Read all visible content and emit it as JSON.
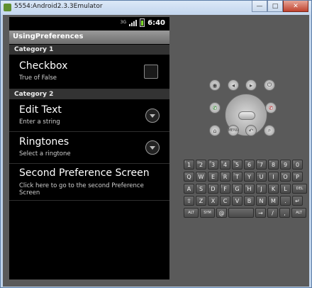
{
  "window": {
    "title": "5554:Android2.3.3Emulator",
    "min": "—",
    "max": "□",
    "close": "✕"
  },
  "status": {
    "net": "3G",
    "clock": "6:40"
  },
  "app": {
    "title": "UsingPreferences"
  },
  "categories": [
    "Category 1",
    "Category 2"
  ],
  "prefs": [
    {
      "title": "Checkbox",
      "summary": "True of False",
      "widget": "checkbox"
    },
    {
      "title": "Edit Text",
      "summary": "Enter a string",
      "widget": "arrow"
    },
    {
      "title": "Ringtones",
      "summary": "Select a ringtone",
      "widget": "arrow"
    },
    {
      "title": "Second Preference Screen",
      "summary": "Click here to go to the second Preference Screen",
      "widget": "none"
    }
  ],
  "hw": {
    "camera": "◉",
    "vol_down": "◂",
    "vol_up": "▸",
    "power": "⏻",
    "call": "✆",
    "end": "✆",
    "home": "⌂",
    "menu": "MENU",
    "back": "↶",
    "search": "⌕"
  },
  "keyboard": {
    "row1": [
      [
        "1",
        "!"
      ],
      [
        "2",
        "@"
      ],
      [
        "3",
        "#"
      ],
      [
        "4",
        "$"
      ],
      [
        "5",
        "%"
      ],
      [
        "6",
        "^"
      ],
      [
        "7",
        "&"
      ],
      [
        "8",
        "*"
      ],
      [
        "9",
        "("
      ],
      [
        "0",
        ")"
      ]
    ],
    "row2": [
      [
        "Q",
        "~"
      ],
      [
        "W",
        "\""
      ],
      [
        "E",
        "`"
      ],
      [
        "R",
        "{"
      ],
      [
        "T",
        "}"
      ],
      [
        "Y",
        "-"
      ],
      [
        "U",
        "_"
      ],
      [
        "I",
        "-"
      ],
      [
        "O",
        "+"
      ],
      [
        "P",
        "="
      ]
    ],
    "row3": [
      [
        "A",
        ""
      ],
      [
        "S",
        "\\"
      ],
      [
        "D",
        "|"
      ],
      [
        "F",
        "["
      ],
      [
        "G",
        "]"
      ],
      [
        "H",
        "<"
      ],
      [
        "J",
        ">"
      ],
      [
        "K",
        ";"
      ],
      [
        "L",
        ":"
      ],
      [
        "DEL",
        ""
      ]
    ],
    "row4": [
      [
        "⇧",
        ""
      ],
      [
        "Z",
        ""
      ],
      [
        "X",
        ""
      ],
      [
        "C",
        ""
      ],
      [
        "V",
        ""
      ],
      [
        "B",
        ""
      ],
      [
        "N",
        ""
      ],
      [
        "M",
        ""
      ],
      [
        ".",
        ""
      ],
      [
        "↵",
        ""
      ]
    ],
    "row5": [
      [
        "ALT",
        ""
      ],
      [
        "SYM",
        ""
      ],
      [
        "@",
        ""
      ],
      [
        "",
        ""
      ],
      [
        "→",
        ""
      ],
      [
        "/",
        ""
      ],
      [
        ",",
        ""
      ],
      [
        "ALT",
        ""
      ]
    ]
  },
  "colors": {
    "screen_bg": "#000000",
    "category_bg": "#333333",
    "title_bar": "#8a8a8a",
    "emulator_body": "#5a5a5a"
  }
}
